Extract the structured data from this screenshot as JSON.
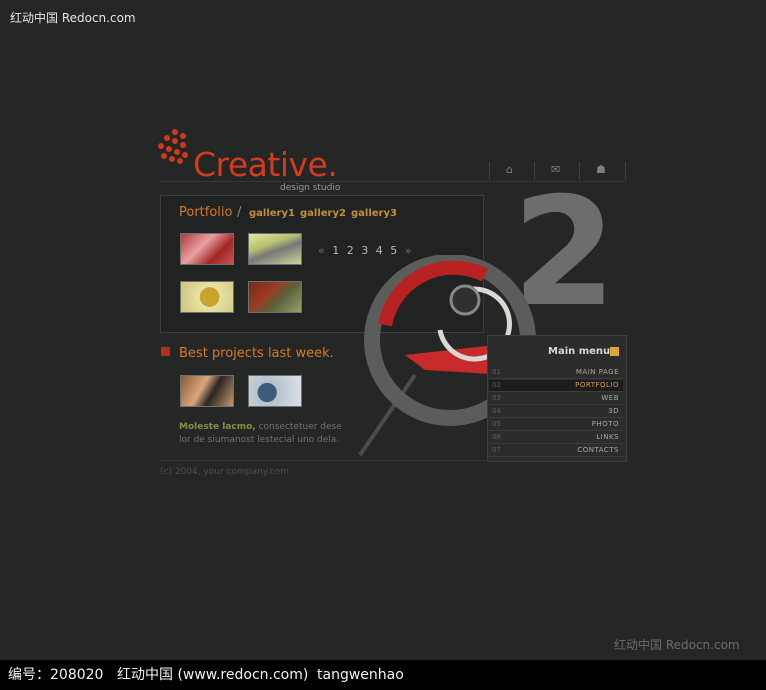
{
  "watermark": {
    "top": "红动中国 Redocn.com",
    "bottom_right": "红动中国 Redocn.com"
  },
  "bottom_bar": {
    "id_label": "编号：208020",
    "site": "红动中国 (www.redocn.com)",
    "author": "tangwenhao"
  },
  "logo": {
    "title": "Creative.",
    "subtitle": "design studio"
  },
  "header_icons": [
    "home-icon",
    "mail-icon",
    "sitemap-icon"
  ],
  "portfolio": {
    "title": "Portfolio",
    "slash": "/",
    "galleries": [
      "gallery1",
      "gallery2",
      "gallery3"
    ],
    "pager": {
      "prev": "«",
      "pages": "1 2 3 4 5",
      "next": "»"
    }
  },
  "big_number": "2",
  "best_projects": {
    "title": "Best projects last week.",
    "desc_bold": "Moleste lacmo,",
    "desc_text": " consectetuer dese lor de siumanost lestecial uno dela."
  },
  "copyright": "(c) 2004, your company.com",
  "menu": {
    "title": "Main menu",
    "items": [
      {
        "num": "01",
        "label": "MAIN PAGE"
      },
      {
        "num": "02",
        "label": "PORTFOLIO"
      },
      {
        "num": "03",
        "label": "WEB"
      },
      {
        "num": "04",
        "label": "3D"
      },
      {
        "num": "05",
        "label": "PHOTO"
      },
      {
        "num": "06",
        "label": "LINKS"
      },
      {
        "num": "07",
        "label": "CONTACTS"
      }
    ],
    "active_index": 1
  },
  "colors": {
    "background": "#242725",
    "accent_orange": "#d97822",
    "logo_red": "#d23b1c",
    "bottom_bar": "#000000"
  }
}
